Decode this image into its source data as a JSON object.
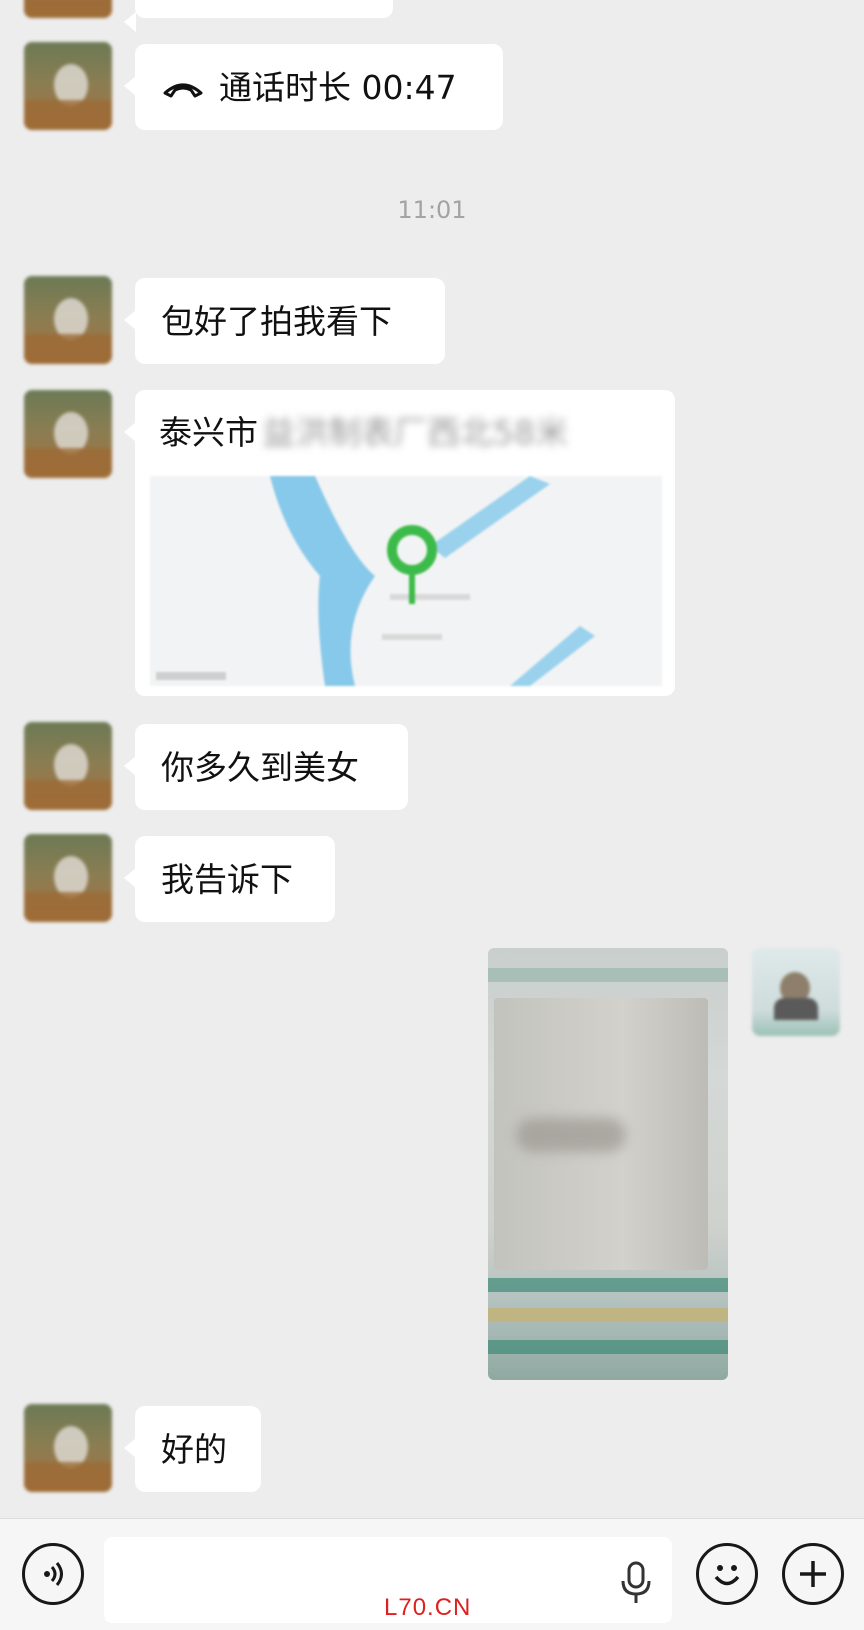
{
  "messages": {
    "call": {
      "icon": "phone-hangup-icon",
      "text": "通话时长 00:47"
    },
    "timestamp": "11:01",
    "m1": "包好了拍我看下",
    "location": {
      "prefix": "泰兴市",
      "blurred": "益洪制表厂西北58米"
    },
    "m2": "你多久到美女",
    "m3": "我告诉下",
    "video": {
      "label": "video-message"
    },
    "m4": "好的"
  },
  "input_bar": {
    "voice_icon": "voice-toggle-icon",
    "mic_icon": "microphone-icon",
    "emoji_icon": "emoji-icon",
    "plus_icon": "plus-icon",
    "text": ""
  },
  "watermark": "L70.CN",
  "colors": {
    "background": "#ededed",
    "bubble": "#ffffff",
    "pin": "#3dbb4a",
    "river": "#87c9ea",
    "watermark": "#e02020"
  }
}
